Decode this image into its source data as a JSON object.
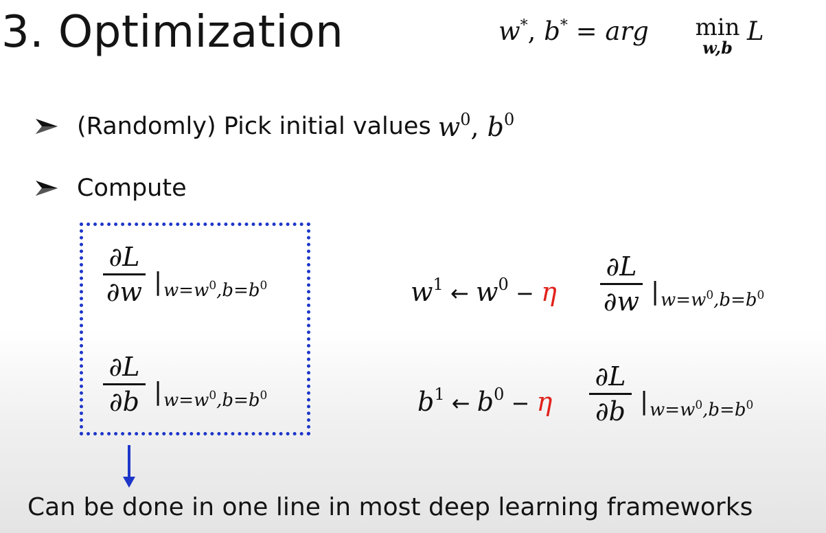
{
  "slide": {
    "title": "3. Optimization",
    "objective": {
      "lhs_w": "w",
      "lhs_b": "b",
      "star": "*",
      "equals": " = ",
      "arg": "arg",
      "min": "min",
      "min_sub": "w,b",
      "loss": "L"
    },
    "bullets": [
      {
        "text": "(Randomly) Pick initial values",
        "math_w": "w",
        "sup_w": "0",
        "math_b": "b",
        "sup_b": "0"
      },
      {
        "text": "Compute"
      }
    ],
    "gradients": {
      "numerator": "∂L",
      "denominator_w": "∂w",
      "denominator_b": "∂b",
      "eval_bar": "|",
      "eval_w": "w",
      "eval_eq1": "=",
      "eval_w0": "w",
      "eval_sup0": "0",
      "eval_comma_b": ",b=",
      "eval_b0": "b",
      "eval_sup0b": "0"
    },
    "updates": {
      "w_lhs": "w",
      "w_lhs_sup": "1",
      "arrow": " ← ",
      "w_rhs": "w",
      "w_rhs_sup": "0",
      "minus": " − ",
      "eta": "η",
      "b_lhs": "b",
      "b_lhs_sup": "1",
      "b_rhs": "b",
      "b_rhs_sup": "0"
    },
    "footer": "Can be done in one line in most deep learning frameworks",
    "colors": {
      "box_border": "#1d36c9",
      "eta": "#e0221b",
      "arrow": "#1d36c9"
    }
  }
}
